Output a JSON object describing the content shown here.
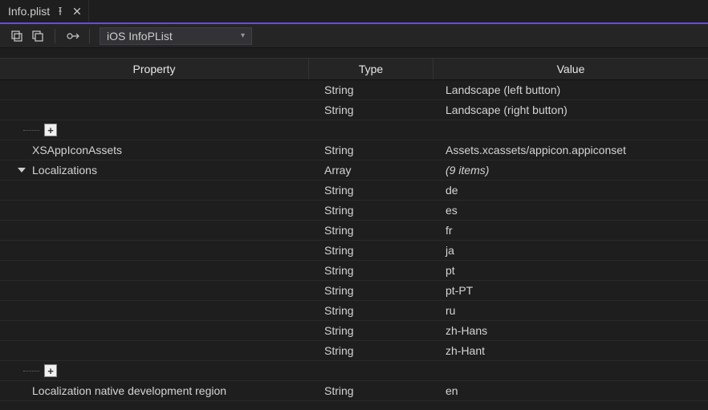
{
  "tab": {
    "title": "Info.plist"
  },
  "toolbar": {
    "dropdown_label": "iOS InfoPList"
  },
  "columns": {
    "property": "Property",
    "type": "Type",
    "value": "Value"
  },
  "rows": {
    "r0": {
      "type": "String",
      "value": "Landscape (left button)"
    },
    "r1": {
      "type": "String",
      "value": "Landscape (right button)"
    },
    "r2": {
      "prop": "XSAppIconAssets",
      "type": "String",
      "value": "Assets.xcassets/appicon.appiconset"
    },
    "r3": {
      "prop": "Localizations",
      "type": "Array",
      "value": "(9 items)"
    },
    "r4": {
      "type": "String",
      "value": "de"
    },
    "r5": {
      "type": "String",
      "value": "es"
    },
    "r6": {
      "type": "String",
      "value": "fr"
    },
    "r7": {
      "type": "String",
      "value": "ja"
    },
    "r8": {
      "type": "String",
      "value": "pt"
    },
    "r9": {
      "type": "String",
      "value": "pt-PT"
    },
    "r10": {
      "type": "String",
      "value": "ru"
    },
    "r11": {
      "type": "String",
      "value": "zh-Hans"
    },
    "r12": {
      "type": "String",
      "value": "zh-Hant"
    },
    "r13": {
      "prop": "Localization native development region",
      "type": "String",
      "value": "en"
    }
  },
  "add_button_label": "+"
}
